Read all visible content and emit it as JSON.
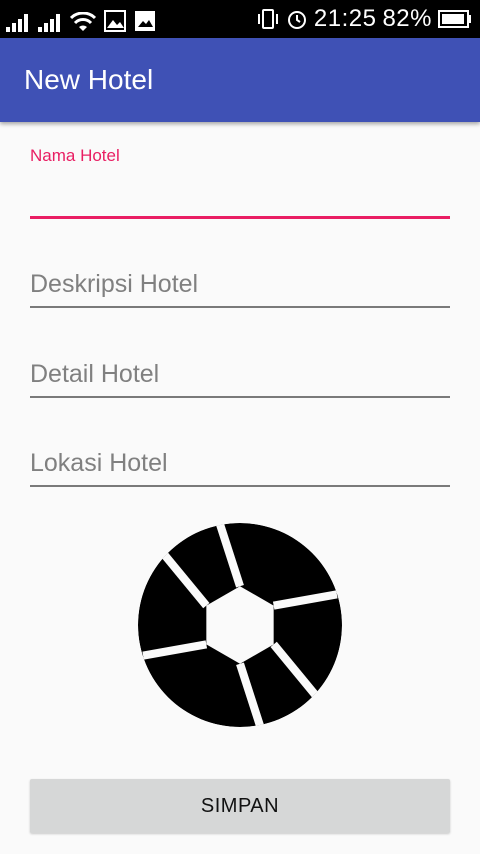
{
  "status_bar": {
    "time": "21:25",
    "battery_percent": "82%",
    "icons_left": [
      "signal-icon",
      "signal-icon",
      "wifi-icon",
      "gallery-icon",
      "image-icon"
    ],
    "icons_right": [
      "vibrate-icon",
      "alarm-icon",
      "battery-icon"
    ]
  },
  "app_bar": {
    "title": "New Hotel",
    "color": "#3f51b5"
  },
  "form": {
    "nama_hotel": {
      "label": "Nama Hotel",
      "value": ""
    },
    "deskripsi_hotel": {
      "placeholder": "Deskripsi Hotel",
      "value": ""
    },
    "detail_hotel": {
      "placeholder": "Detail Hotel",
      "value": ""
    },
    "lokasi_hotel": {
      "placeholder": "Lokasi Hotel",
      "value": ""
    }
  },
  "image": {
    "icon": "camera-shutter-icon"
  },
  "save_button": {
    "label": "SIMPAN"
  },
  "colors": {
    "accent": "#e91e63",
    "primary": "#3f51b5",
    "button": "#d6d7d7"
  }
}
